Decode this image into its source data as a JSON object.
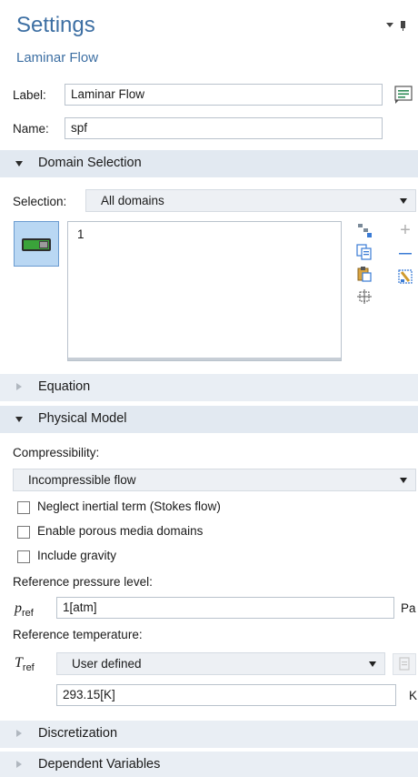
{
  "header": {
    "title": "Settings",
    "subtitle": "Laminar Flow",
    "window_controls": "▾ ▮"
  },
  "label_field": {
    "label": "Label:",
    "value": "Laminar Flow",
    "button_icon": "edit-label-icon"
  },
  "name_field": {
    "label": "Name:",
    "value": "spf"
  },
  "sections": {
    "domain_selection": "Domain Selection",
    "equation": "Equation",
    "physical_model": "Physical Model",
    "discretization": "Discretization",
    "dependent_variables": "Dependent Variables"
  },
  "domain_selection": {
    "selection_label": "Selection:",
    "selection_value": "All domains",
    "list_items": [
      "1"
    ]
  },
  "physical_model": {
    "compressibility_label": "Compressibility:",
    "compressibility_value": "Incompressible flow",
    "checkboxes": [
      {
        "label": "Neglect inertial term (Stokes flow)",
        "checked": false
      },
      {
        "label": "Enable porous media domains",
        "checked": false
      },
      {
        "label": "Include gravity",
        "checked": false
      }
    ],
    "ref_pressure_label": "Reference pressure level:",
    "p_symbol": "p",
    "p_sub": "ref",
    "p_value": "1[atm]",
    "p_unit": "Pa",
    "ref_temp_label": "Reference temperature:",
    "t_symbol": "T",
    "t_sub": "ref",
    "t_mode": "User defined",
    "t_value": "293.15[K]",
    "t_unit": "K"
  },
  "colors": {
    "accent": "#3d6fa3",
    "section_bg": "#e2e9f1",
    "combo_bg": "#edf0f4",
    "selection_btn": "#b9d7f3"
  }
}
